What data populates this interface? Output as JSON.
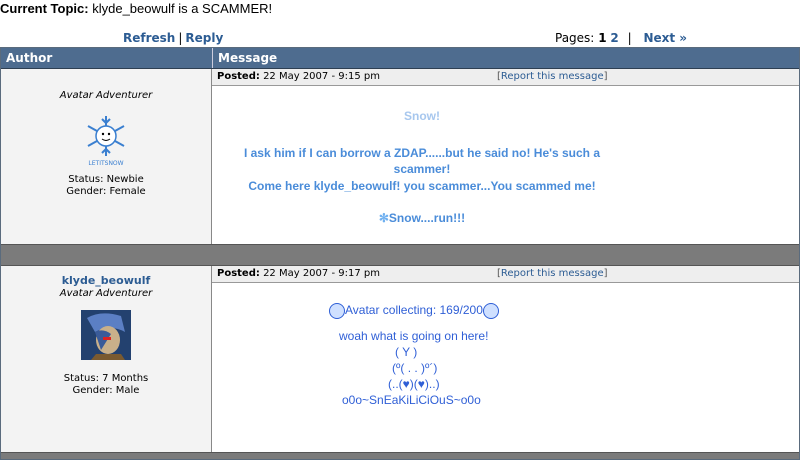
{
  "topic": {
    "label": "Current Topic:",
    "title": "klyde_beowulf is a SCAMMER!"
  },
  "actions": {
    "refresh": "Refresh",
    "separator": "|",
    "reply": "Reply"
  },
  "pagination": {
    "label": "Pages:",
    "current": "1",
    "other": "2",
    "separator": "|",
    "next": "Next »"
  },
  "table_headers": {
    "author": "Author",
    "message": "Message"
  },
  "posts": [
    {
      "author_name": "",
      "rank": "Avatar Adventurer",
      "avatar_icon": "snowflake-avatar",
      "avatar_caption": "LETITSNOW",
      "status": "Status: Newbie",
      "gender": "Gender: Female",
      "posted_label": "Posted:",
      "posted_date": "22 May 2007 - 9:15 pm",
      "report": "Report this message",
      "lines": [
        "Snow!",
        "I ask him if I can borrow a ZDAP......but he said no! He's such a",
        "scammer!",
        "Come here klyde_beowulf! you scammer...You scammed me!",
        "Snow....run!!!"
      ]
    },
    {
      "author_name": "klyde_beowulf",
      "rank": "Avatar Adventurer",
      "avatar_icon": "character-avatar",
      "status": "Status: 7 Months",
      "gender": "Gender: Male",
      "posted_label": "Posted:",
      "posted_date": "22 May 2007 - 9:17 pm",
      "report": "Report this message",
      "lines": [
        "Avatar collecting: 169/200",
        "woah what is going on here!",
        "( Y )",
        "(º( . . )º´)",
        "(..(♥)(♥)..)",
        "o0o~SnEaKiLiCiOuS~o0o"
      ]
    }
  ],
  "colors": {
    "header_bg": "#4e6c8f",
    "link": "#2c5c93",
    "post1_text": "#4a8cd9",
    "post2_text": "#2f5fd6",
    "separator": "#7b7b7b"
  }
}
